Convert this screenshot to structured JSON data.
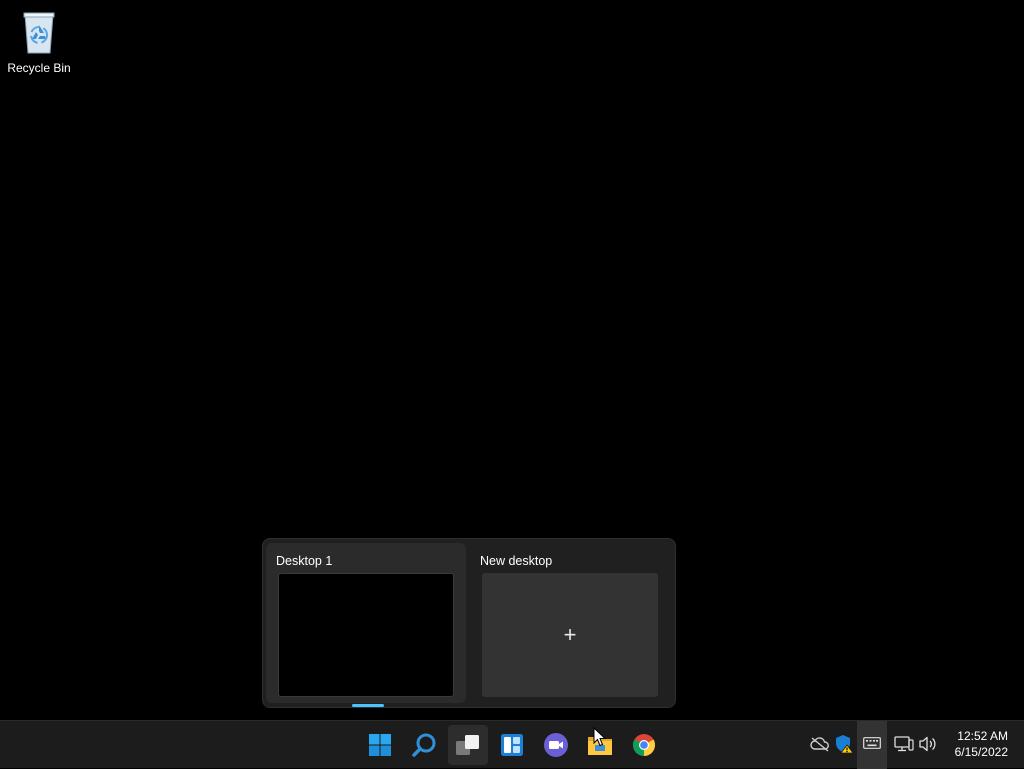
{
  "desktop": {
    "icons": [
      {
        "label": "Recycle Bin",
        "icon": "recycle-bin-icon"
      }
    ]
  },
  "task_view": {
    "desktops": [
      {
        "title": "Desktop 1",
        "active": true
      },
      {
        "title": "New desktop",
        "is_new": true,
        "symbol": "+"
      }
    ],
    "accent_color": "#4cc2ff"
  },
  "taskbar": {
    "apps": [
      {
        "name": "start",
        "icon": "windows-start-icon"
      },
      {
        "name": "search",
        "icon": "search-icon"
      },
      {
        "name": "task-view",
        "icon": "task-view-icon",
        "active": true
      },
      {
        "name": "widgets",
        "icon": "widgets-icon"
      },
      {
        "name": "teams-chat",
        "icon": "teams-chat-icon"
      },
      {
        "name": "file-explorer",
        "icon": "file-explorer-icon"
      },
      {
        "name": "chrome",
        "icon": "chrome-icon"
      }
    ],
    "tray": {
      "icons": [
        "onedrive-offline-icon",
        "security-warning-icon",
        "keyboard-icon",
        "network-icon",
        "volume-icon"
      ],
      "time": "12:52 AM",
      "date": "6/15/2022"
    }
  }
}
